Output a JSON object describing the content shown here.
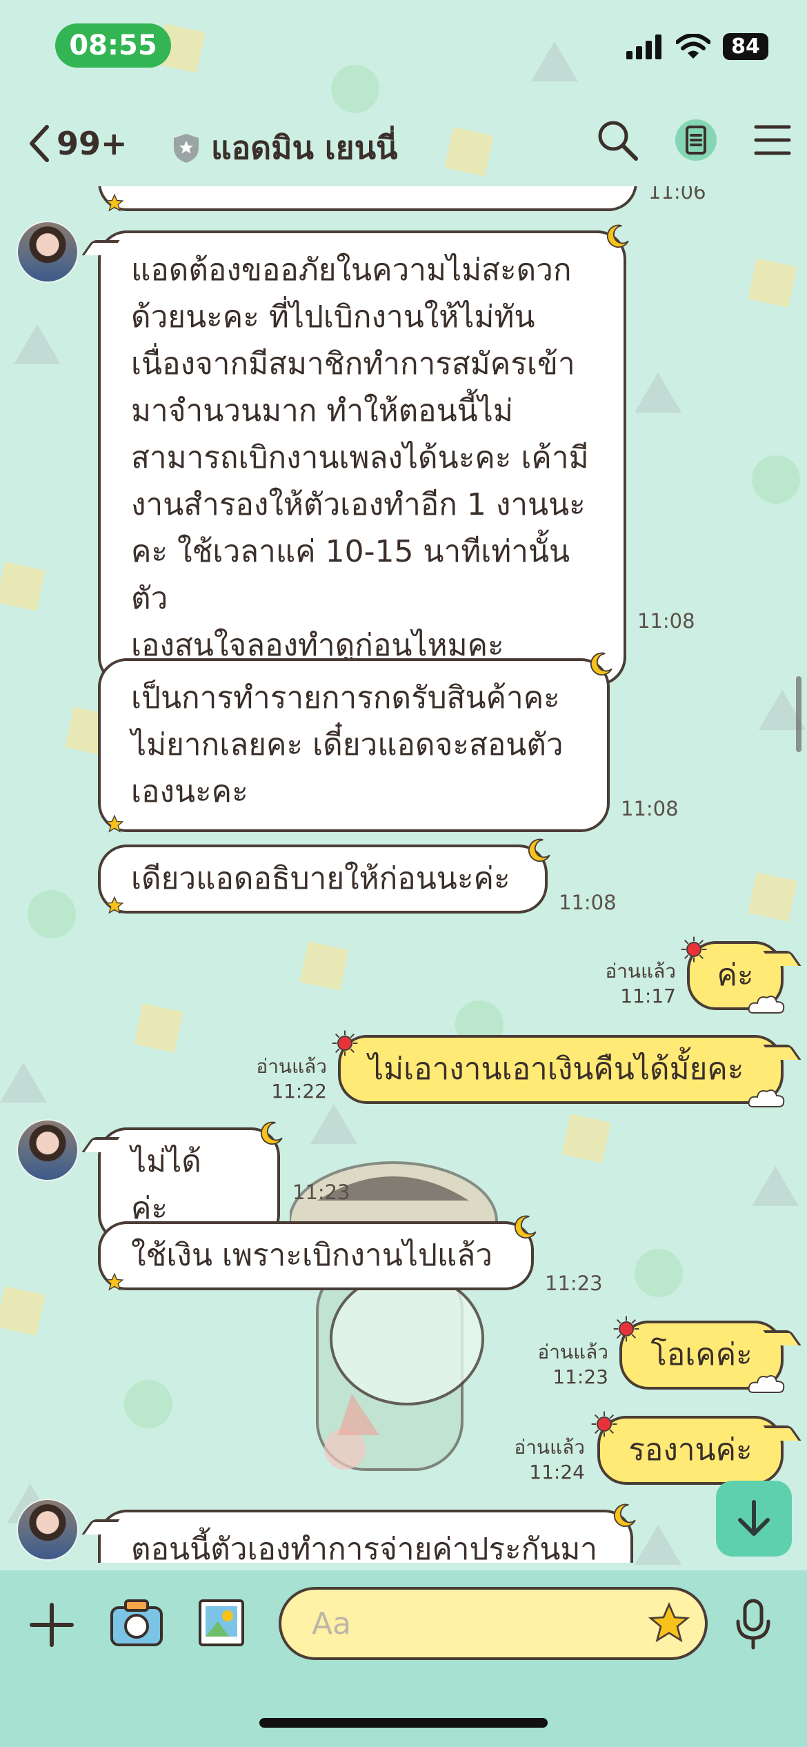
{
  "status": {
    "time": "08:55",
    "battery": "84"
  },
  "header": {
    "back_count": "99+",
    "title": "แอดมิน เยนนี่"
  },
  "messages": {
    "m0_time": "11:06",
    "m1_lines": [
      "แอดต้องขออภัยในความไม่สะดวก",
      "ด้วยนะคะ  ที่ไปเบิกงานให้ไม่ทัน",
      "เนื่องจากมีสมาชิกทำการสมัครเข้า",
      "มาจำนวนมาก ทำให้ตอนนี้ไม่",
      "สามารถเบิกงานเพลงได้นะคะ เค้ามี",
      "งานสำรองให้ตัวเองทำอีก 1 งานนะ",
      "คะ ใช้เวลาแค่ 10-15 นาทีเท่านั้นตัว",
      "เองสนใจลองทำดูก่อนไหมคะ"
    ],
    "m1_time": "11:08",
    "m2_lines": [
      "เป็นการทำรายการกดรับสินค้าคะ",
      "ไม่ยากเลยคะ เดี๋ยวแอดจะสอนตัว",
      "เองนะคะ"
    ],
    "m2_time": "11:08",
    "m3_text": "เดียวแอดอธิบายให้ก่อนนะค่ะ",
    "m3_time": "11:08",
    "m4_read": "อ่านแล้ว",
    "m4_time": "11:17",
    "m4_text": "ค่ะ",
    "m5_read": "อ่านแล้ว",
    "m5_time": "11:22",
    "m5_text": "ไม่เอางานเอาเงินคืนได้มั้ยคะ",
    "m6_text": "ไม่ได้ ค่ะ",
    "m6_time": "11:23",
    "m7_text": "ใช้เงิน เพราะเบิกงานไปแล้ว",
    "m7_time": "11:23",
    "m8_read": "อ่านแล้ว",
    "m8_time": "11:23",
    "m8_text": "โอเคค่ะ",
    "m9_read": "อ่านแล้ว",
    "m9_time": "11:24",
    "m9_text": "รองานค่ะ",
    "m10_text": "ตอนนี้ตัวเองทำการจ่ายค่าประกันมา"
  },
  "composer": {
    "placeholder": "Aa"
  },
  "colors": {
    "accent_green": "#33b554",
    "bubble_out": "#ffea76",
    "background": "#cdeee3",
    "fab": "#5fd0ad"
  }
}
